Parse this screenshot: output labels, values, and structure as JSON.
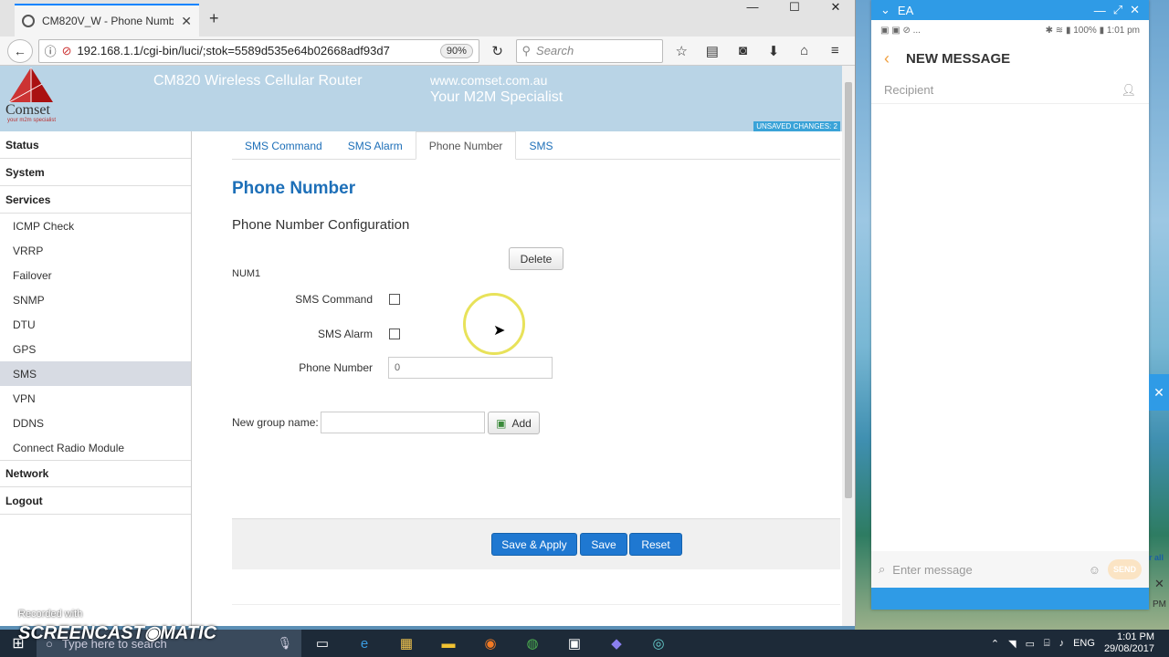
{
  "browser": {
    "tab_title": "CM820V_W - Phone Numbe",
    "new_tab": "+",
    "url": "192.168.1.1/cgi-bin/luci/;stok=5589d535e64b02668adf93d7",
    "zoom": "90%",
    "search_placeholder": "Search",
    "win_min": "—",
    "win_max": "☐",
    "win_close": "✕"
  },
  "banner": {
    "brand": "Comset",
    "tagline": "your m2m specialist",
    "title": "CM820 Wireless Cellular Router",
    "site": "www.comset.com.au",
    "slogan": "Your M2M Specialist",
    "unsaved": "UNSAVED CHANGES: 2"
  },
  "sidebar": {
    "status": "Status",
    "system": "System",
    "services": "Services",
    "items": [
      "ICMP Check",
      "VRRP",
      "Failover",
      "SNMP",
      "DTU",
      "GPS",
      "SMS",
      "VPN",
      "DDNS",
      "Connect Radio Module"
    ],
    "network": "Network",
    "logout": "Logout"
  },
  "tabs": [
    "SMS Command",
    "SMS Alarm",
    "Phone Number",
    "SMS"
  ],
  "main": {
    "title": "Phone Number",
    "subtitle": "Phone Number Configuration",
    "delete": "Delete",
    "num_label": "NUM1",
    "sms_command": "SMS Command",
    "sms_alarm": "SMS Alarm",
    "phone_number": "Phone Number",
    "phone_value": "0",
    "new_group": "New group name:",
    "add": "Add",
    "save_apply": "Save & Apply",
    "save": "Save",
    "reset": "Reset"
  },
  "phone": {
    "top_label": "EA",
    "status_left": "▣ ▣ ⊘ ...",
    "status_right": "✱ ≋ ▮ 100% ▮ 1:01 pm",
    "header": "NEW MESSAGE",
    "recipient": "Recipient",
    "compose_placeholder": "Enter message",
    "send": "SEND",
    "side_text": "r all",
    "side_pm": "PM"
  },
  "taskbar": {
    "search": "Type here to search",
    "lang": "ENG",
    "time": "1:01 PM",
    "date": "29/08/2017"
  },
  "watermark": {
    "line1": "Recorded with",
    "line2": "SCREENCAST◉MATIC"
  }
}
